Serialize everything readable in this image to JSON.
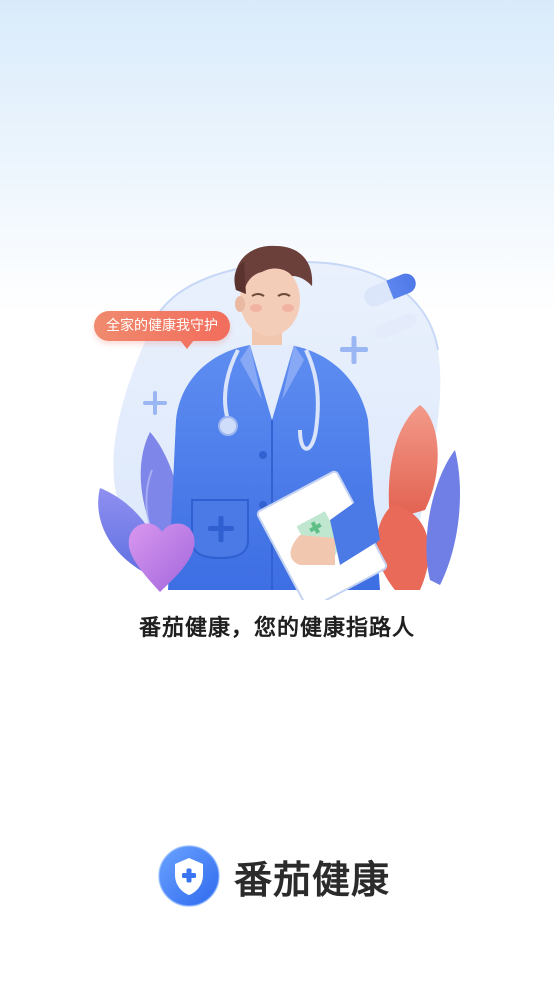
{
  "splash": {
    "bubble_text": "全家的健康我守护",
    "tagline": "番茄健康，您的健康指路人",
    "brand_name": "番茄健康"
  },
  "icons": {
    "illustration": "doctor-illustration",
    "logo": "shield-plus-logo-icon"
  },
  "colors": {
    "primary_blue": "#3f7ff0",
    "bubble_orange": "#f27462",
    "brand_text": "#2b2b2b"
  }
}
